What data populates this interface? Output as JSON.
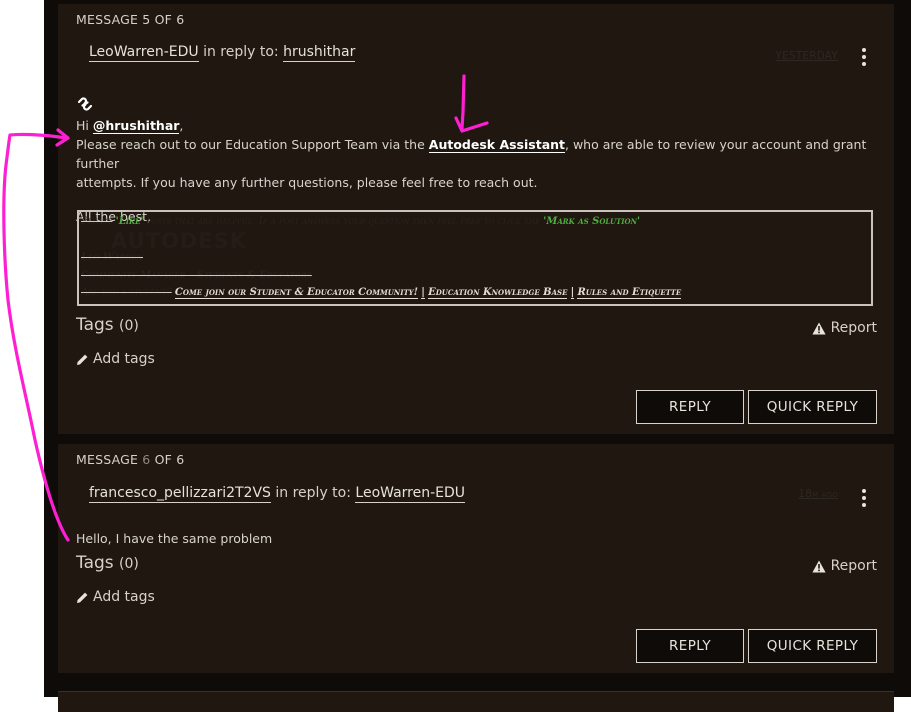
{
  "messages": [
    {
      "count": "MESSAGE 5 OF 6",
      "author": "LeoWarren-EDU",
      "in_reply_to": "in reply to:",
      "reply_target": "hrushithar",
      "date": "YESTERDAY",
      "greeting_hi": "Hi",
      "mention": "@hrushithar",
      "greeting_comma": ",",
      "body_part1": "Please reach out to our Education Support Team via the",
      "body_link": "Autodesk Assistant",
      "body_part2": ", who are able to review your account and grant further",
      "body_line2": "attempts. If you have any further questions, please feel free to reach out.",
      "closing": "All the best,",
      "signature": {
        "line1_a": "Please",
        "line1_like": "'Like'",
        "line1_b": "posts that are helpful. If a post answers your question then feel free to click the",
        "line1_solution": "'Mark as Solution'",
        "logo": "AUTODESK",
        "name": "Leo Warren",
        "role": "Community Manager - Students & Educators",
        "student_q": "Are you a student?",
        "link1": "Come join our Student & Educator Community!",
        "sep": "|",
        "link2": "Education Knowledge Base",
        "link3": "Rules and Etiquette"
      },
      "tags_label": "Tags",
      "tags_count": "(0)",
      "report": "Report",
      "add_tags": "Add tags",
      "reply": "REPLY",
      "quick_reply": "QUICK REPLY"
    },
    {
      "count_prefix": "MESSAGE",
      "count_num": "6",
      "count_suffix": "OF 6",
      "author": "francesco_pellizzari2T2VS",
      "in_reply_to": "in reply to:",
      "reply_target": "LeoWarren-EDU",
      "date": "18m ago",
      "body": "Hello, I have the same problem",
      "tags_label": "Tags",
      "tags_count": "(0)",
      "report": "Report",
      "add_tags": "Add tags",
      "reply": "REPLY",
      "quick_reply": "QUICK REPLY"
    }
  ],
  "colors": {
    "page_bg": "#0e0b08",
    "card_bg": "#1f1710",
    "annotation": "#ff1fd2",
    "like_green": "#4fae3f"
  }
}
